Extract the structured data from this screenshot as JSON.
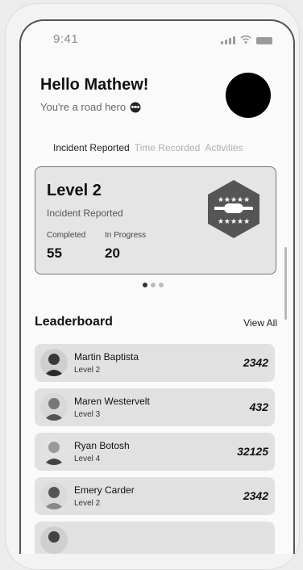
{
  "status_bar": {
    "time": "9:41"
  },
  "header": {
    "greeting": "Hello Mathew!",
    "subtitle": "You're a road hero"
  },
  "tabs": [
    {
      "label": "Incident Reported",
      "active": true
    },
    {
      "label": "Time Recorded",
      "active": false
    },
    {
      "label": "Activities",
      "active": false
    }
  ],
  "level_card": {
    "title": "Level 2",
    "subtitle": "Incident Reported",
    "completed_label": "Completed",
    "completed_value": "55",
    "in_progress_label": "In Progress",
    "in_progress_value": "20",
    "badge_icon": "hexagon-star-badge-icon"
  },
  "carousel": {
    "pages": 3,
    "active_index": 0
  },
  "leaderboard": {
    "title": "Leaderboard",
    "view_all": "View All",
    "items": [
      {
        "name": "Martin Baptista",
        "level": "Level 2",
        "score": "2342"
      },
      {
        "name": "Maren Westervelt",
        "level": "Level 3",
        "score": "432"
      },
      {
        "name": "Ryan Botosh",
        "level": "Level 4",
        "score": "32125"
      },
      {
        "name": "Emery Carder",
        "level": "Level 2",
        "score": "2342"
      }
    ]
  }
}
